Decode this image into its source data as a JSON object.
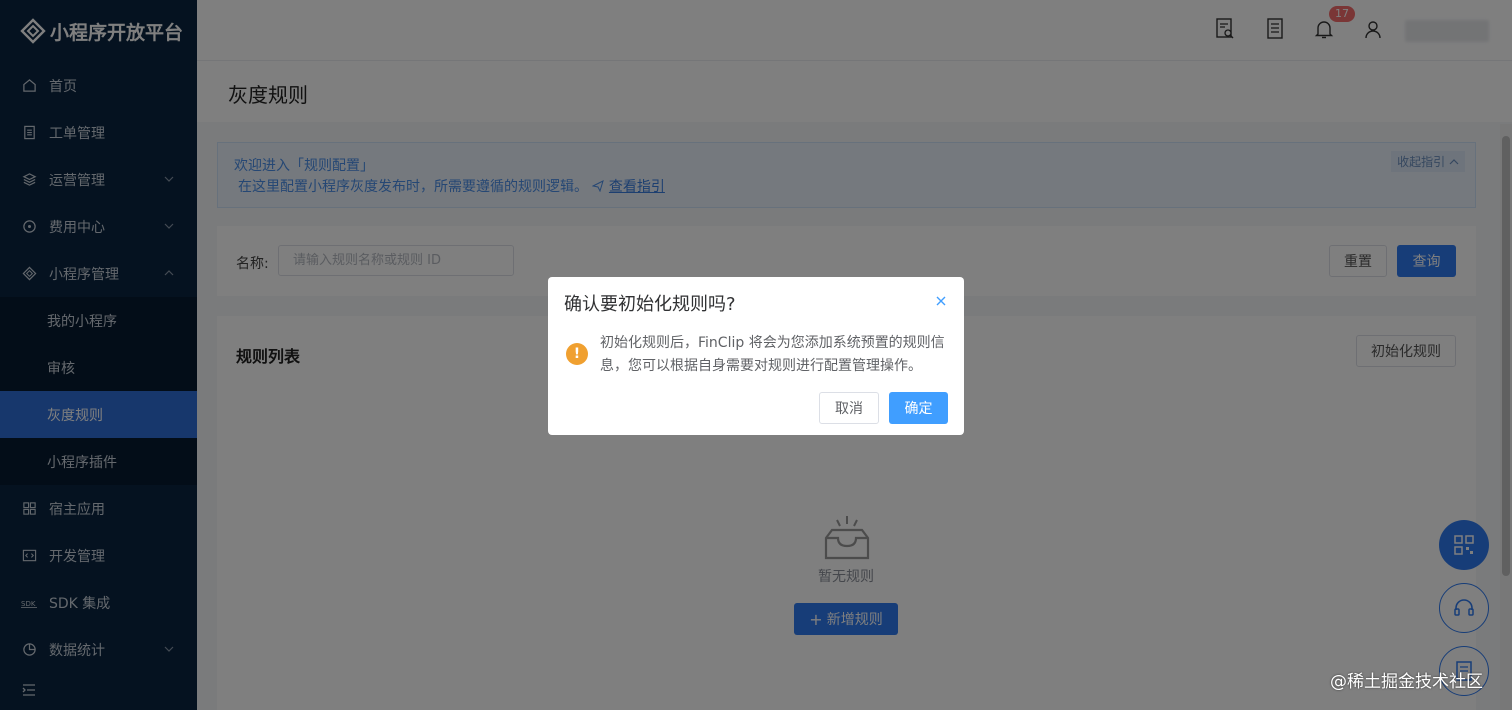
{
  "app": {
    "title": "小程序开放平台"
  },
  "sidebar": {
    "items": [
      {
        "label": "首页",
        "icon": "home-icon"
      },
      {
        "label": "工单管理",
        "icon": "ticket-icon"
      },
      {
        "label": "运营管理",
        "icon": "layers-icon"
      },
      {
        "label": "费用中心",
        "icon": "coin-icon"
      },
      {
        "label": "小程序管理",
        "icon": "miniapp-icon"
      }
    ],
    "sub_items": [
      {
        "label": "我的小程序"
      },
      {
        "label": "审核"
      },
      {
        "label": "灰度规则"
      },
      {
        "label": "小程序插件"
      }
    ],
    "items_after": [
      {
        "label": "宿主应用",
        "icon": "grid-icon"
      },
      {
        "label": "开发管理",
        "icon": "code-icon"
      },
      {
        "label": "SDK 集成",
        "icon": "sdk-icon"
      },
      {
        "label": "数据统计",
        "icon": "pie-chart-icon"
      }
    ]
  },
  "header": {
    "notification_count": "17"
  },
  "page": {
    "title": "灰度规则"
  },
  "guide": {
    "line1": "欢迎进入「规则配置」",
    "line2": "在这里配置小程序灰度发布时，所需要遵循的规则逻辑。",
    "link": "查看指引",
    "collapse": "收起指引"
  },
  "filter": {
    "label": "名称:",
    "placeholder": "请输入规则名称或规则 ID",
    "reset": "重置",
    "query": "查询"
  },
  "rules_list": {
    "title": "规则列表",
    "init_button": "初始化规则",
    "empty_text": "暂无规则",
    "new_button": "新增规则"
  },
  "dialog": {
    "title": "确认要初始化规则吗?",
    "message": "初始化规则后，FinClip 将会为您添加系统预置的规则信息，您可以根据自身需要对规则进行配置管理操作。",
    "cancel": "取消",
    "confirm": "确定"
  },
  "watermark": "@稀土掘金技术社区",
  "colors": {
    "sidebar_bg": "#0a2540",
    "primary": "#2f7bf0",
    "active": "#2f6fd8",
    "warning": "#f0a030"
  }
}
